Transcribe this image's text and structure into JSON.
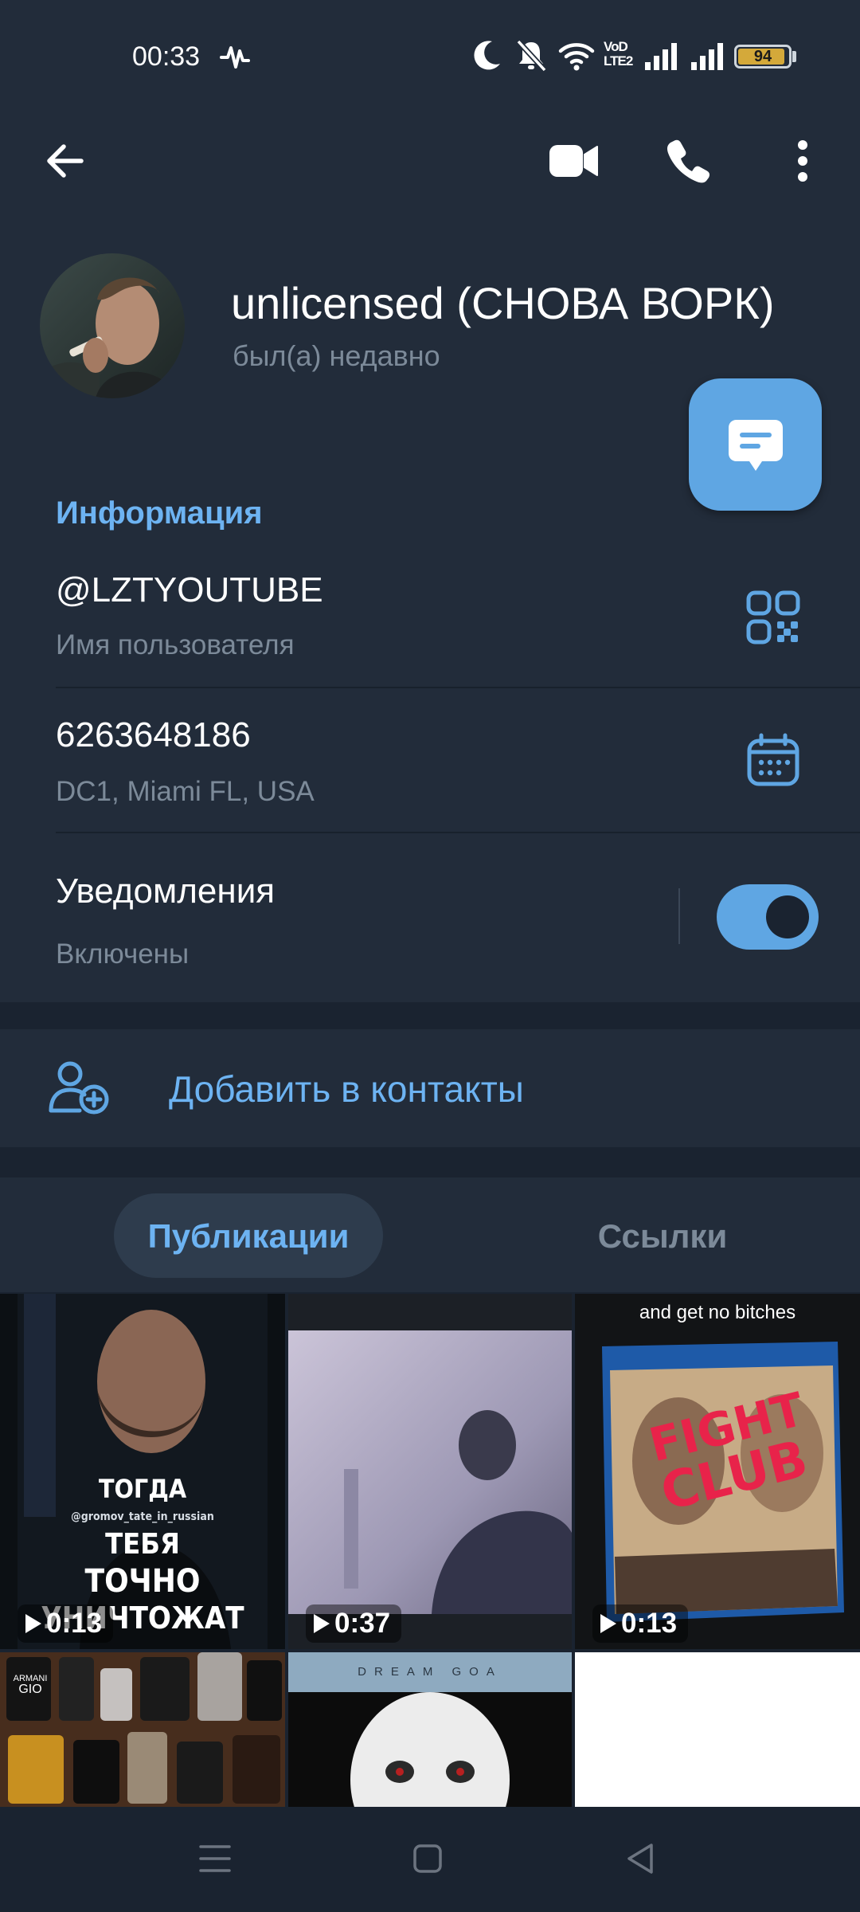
{
  "status_bar": {
    "time": "00:33",
    "battery_level": "94",
    "battery_fraction": 0.94,
    "network_label_top": "VoD",
    "network_label_bottom": "LTE2",
    "icons": [
      "pulse-icon",
      "moon-icon",
      "bell-off-icon",
      "wifi-icon",
      "signal-icon",
      "signal-icon",
      "battery-icon"
    ]
  },
  "toolbar": {
    "icons": [
      "back-arrow-icon",
      "video-call-icon",
      "phone-icon",
      "more-vert-icon"
    ]
  },
  "profile": {
    "name": "unlicensed (СНОВА ВОРК)",
    "status": "был(а) недавно",
    "fab_icon": "message-icon"
  },
  "info": {
    "header": "Информация",
    "username": "@LZTYOUTUBE",
    "username_label": "Имя пользователя",
    "user_id": "6263648186",
    "dc_location": "DC1, Miami FL, USA",
    "notifications": "Уведомления",
    "notifications_state": "Включены",
    "notifications_on": true
  },
  "add_contact": {
    "label": "Добавить в контакты"
  },
  "tabs": [
    {
      "label": "Публикации",
      "active": true
    },
    {
      "label": "Ссылки",
      "active": false
    }
  ],
  "media": [
    {
      "duration": "0:13",
      "text_lines": [
        "ТОГДА",
        "ТЕБЯ",
        "ТОЧНО",
        "УНИЧТОЖАТ"
      ],
      "watermark": "@gromov_tate_in_russian"
    },
    {
      "duration": "0:37"
    },
    {
      "duration": "0:13",
      "caption": "and get no bitches",
      "poster_title_1": "FIGHT",
      "poster_title_2": "CLUB"
    },
    {
      "duration": "",
      "labels": [
        "ARMANI",
        "GIO"
      ]
    },
    {
      "duration": "",
      "caption": "DREAM GOA"
    },
    {
      "duration": ""
    }
  ],
  "nav": {
    "icons": [
      "menu-icon",
      "home-square-icon",
      "back-triangle-icon"
    ]
  }
}
